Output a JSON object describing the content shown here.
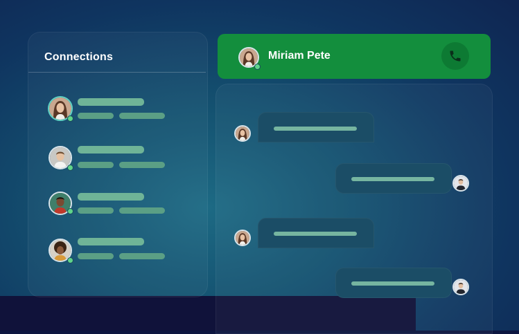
{
  "connections": {
    "title": "Connections",
    "contacts": [
      {
        "avatar": "woman-long-hair-avatar",
        "ring_color": "#5fd3c4"
      },
      {
        "avatar": "man-short-hair-avatar",
        "ring_color": "#d9e4ea"
      },
      {
        "avatar": "man-dark-skin-avatar",
        "ring_color": "#d9e4ea"
      },
      {
        "avatar": "man-curly-hair-avatar",
        "ring_color": "#d9e4ea"
      }
    ]
  },
  "chat": {
    "contact_name": "Miriam Pete",
    "call_icon": "phone-icon",
    "header_color": "#138e3d",
    "messages": [
      {
        "from": "contact"
      },
      {
        "from": "me"
      },
      {
        "from": "contact"
      },
      {
        "from": "me"
      }
    ]
  },
  "colors": {
    "accent_green": "#138e3d",
    "placeholder_bar": "#6fb497",
    "online_dot": "#5fd48a"
  }
}
